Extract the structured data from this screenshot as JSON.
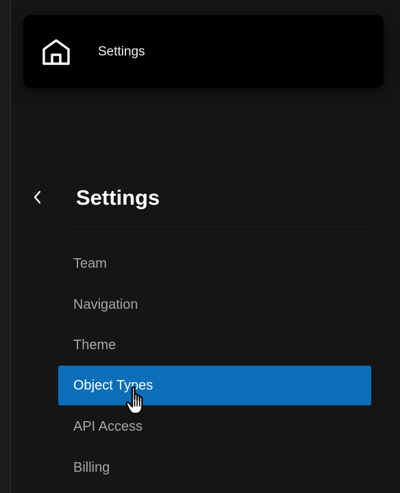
{
  "header": {
    "icon": "home-icon",
    "title": "Settings"
  },
  "settings_panel": {
    "back_icon": "chevron-left-icon",
    "title": "Settings",
    "items": [
      {
        "label": "Team",
        "active": false
      },
      {
        "label": "Navigation",
        "active": false
      },
      {
        "label": "Theme",
        "active": false
      },
      {
        "label": "Object Types",
        "active": true
      },
      {
        "label": "API Access",
        "active": false
      },
      {
        "label": "Billing",
        "active": false
      }
    ]
  },
  "colors": {
    "background": "#151515",
    "card": "#000000",
    "active_item": "#0b6eb8",
    "inactive_text": "#a6a6a6",
    "active_text": "#ffffff"
  },
  "cursor": {
    "icon": "hand-pointer-icon"
  }
}
